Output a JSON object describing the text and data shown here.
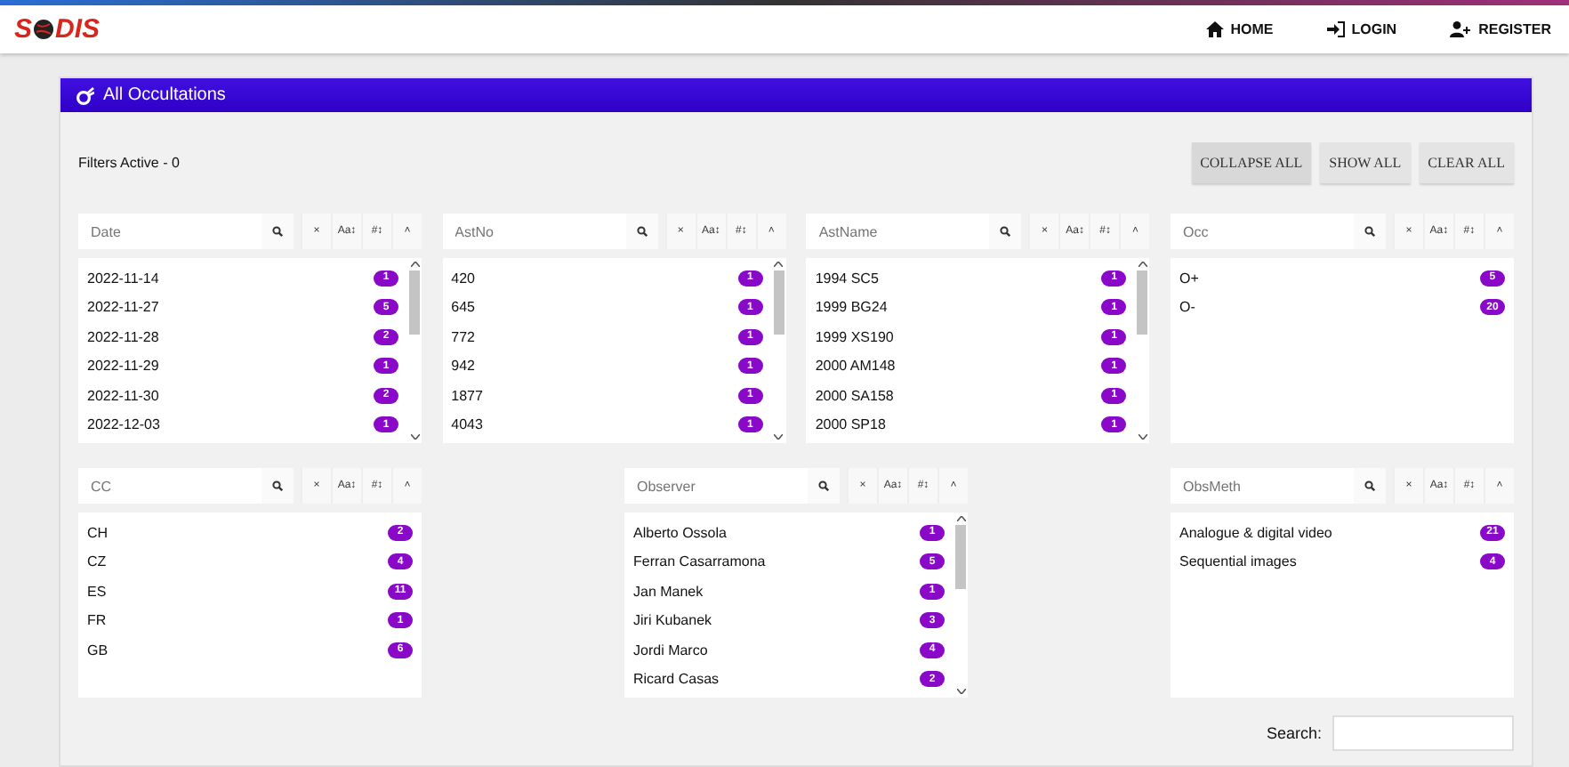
{
  "brand": {
    "name_start": "S",
    "name_end": "DIS"
  },
  "nav": [
    {
      "kind": "home",
      "label": "HOME"
    },
    {
      "kind": "login",
      "label": "LOGIN"
    },
    {
      "kind": "register",
      "label": "REGISTER"
    }
  ],
  "card": {
    "title": "All Occultations",
    "filters_active": "Filters Active - 0",
    "actions": [
      "COLLAPSE ALL",
      "SHOW ALL",
      "CLEAR ALL"
    ],
    "panels": [
      {
        "placeholder": "Date",
        "tools": [
          "×",
          "Aa↕",
          "#↕",
          "˄"
        ],
        "items": [
          {
            "label": "2022-11-14",
            "count": "1"
          },
          {
            "label": "2022-11-27",
            "count": "5"
          },
          {
            "label": "2022-11-28",
            "count": "2"
          },
          {
            "label": "2022-11-29",
            "count": "1"
          },
          {
            "label": "2022-11-30",
            "count": "2"
          },
          {
            "label": "2022-12-03",
            "count": "1"
          }
        ]
      },
      {
        "placeholder": "AstNo",
        "tools": [
          "×",
          "Aa↕",
          "#↕",
          "˄"
        ],
        "items": [
          {
            "label": "420",
            "count": "1"
          },
          {
            "label": "645",
            "count": "1"
          },
          {
            "label": "772",
            "count": "1"
          },
          {
            "label": "942",
            "count": "1"
          },
          {
            "label": "1877",
            "count": "1"
          },
          {
            "label": "4043",
            "count": "1"
          }
        ]
      },
      {
        "placeholder": "AstName",
        "tools": [
          "×",
          "Aa↕",
          "#↕",
          "˄"
        ],
        "items": [
          {
            "label": "1994 SC5",
            "count": "1"
          },
          {
            "label": "1999 BG24",
            "count": "1"
          },
          {
            "label": "1999 XS190",
            "count": "1"
          },
          {
            "label": "2000 AM148",
            "count": "1"
          },
          {
            "label": "2000 SA158",
            "count": "1"
          },
          {
            "label": "2000 SP18",
            "count": "1"
          }
        ]
      },
      {
        "placeholder": "Occ",
        "tools": [
          "×",
          "Aa↕",
          "#↕",
          "˄"
        ],
        "items": [
          {
            "label": "O+",
            "count": "5"
          },
          {
            "label": "O-",
            "count": "20"
          }
        ]
      },
      {
        "placeholder": "CC",
        "tools": [
          "×",
          "Aa↕",
          "#↕",
          "˄"
        ],
        "items": [
          {
            "label": "CH",
            "count": "2"
          },
          {
            "label": "CZ",
            "count": "4"
          },
          {
            "label": "ES",
            "count": "11"
          },
          {
            "label": "FR",
            "count": "1"
          },
          {
            "label": "GB",
            "count": "6"
          }
        ]
      },
      {
        "placeholder": "Observer",
        "tools": [
          "×",
          "Aa↕",
          "#↕",
          "˄"
        ],
        "items": [
          {
            "label": "Alberto Ossola",
            "count": "1"
          },
          {
            "label": "Ferran Casarramona",
            "count": "5"
          },
          {
            "label": "Jan Manek",
            "count": "1"
          },
          {
            "label": "Jiri Kubanek",
            "count": "3"
          },
          {
            "label": "Jordi Marco",
            "count": "4"
          },
          {
            "label": "Ricard Casas",
            "count": "2"
          }
        ]
      },
      {
        "placeholder": "ObsMeth",
        "tools": [
          "×",
          "Aa↕",
          "#↕",
          "˄"
        ],
        "items": [
          {
            "label": "Analogue & digital video",
            "count": "21"
          },
          {
            "label": "Sequential images",
            "count": "4"
          }
        ]
      }
    ],
    "search": {
      "label": "Search:"
    }
  }
}
